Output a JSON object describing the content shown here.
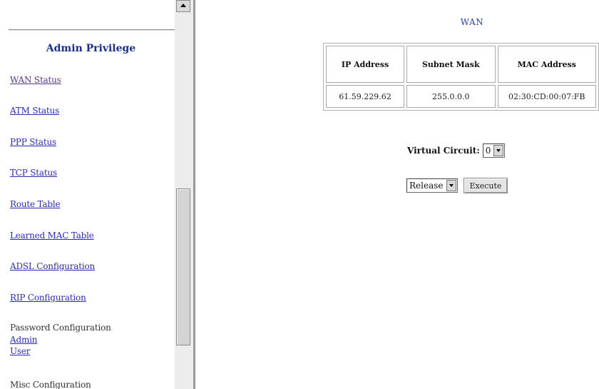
{
  "sidebar": {
    "heading": "Admin Privilege",
    "items": [
      {
        "label": "WAN Status"
      },
      {
        "label": "ATM Status"
      },
      {
        "label": "PPP Status"
      },
      {
        "label": "TCP Status"
      },
      {
        "label": "Route Table"
      },
      {
        "label": "Learned MAC Table"
      },
      {
        "label": "ADSL Configuration"
      },
      {
        "label": "RIP Configuration"
      },
      {
        "label": "Password Configuration"
      },
      {
        "label": "Admin"
      },
      {
        "label": "User"
      },
      {
        "label": "Misc Configuration"
      }
    ]
  },
  "main": {
    "title": "WAN",
    "table": {
      "headers": [
        "IP Address",
        "Subnet Mask",
        "MAC Address"
      ],
      "rows": [
        [
          "61.59.229.62",
          "255.0.0.0",
          "02:30:CD:00:07:FB"
        ]
      ]
    },
    "virtual_circuit": {
      "label": "Virtual Circuit:",
      "value": "0"
    },
    "action": {
      "select_value": "Release",
      "execute_label": "Execute"
    }
  },
  "colors": {
    "link": "#2b2bb0",
    "heading": "#1a2e8a",
    "title": "#2b3ea0"
  }
}
